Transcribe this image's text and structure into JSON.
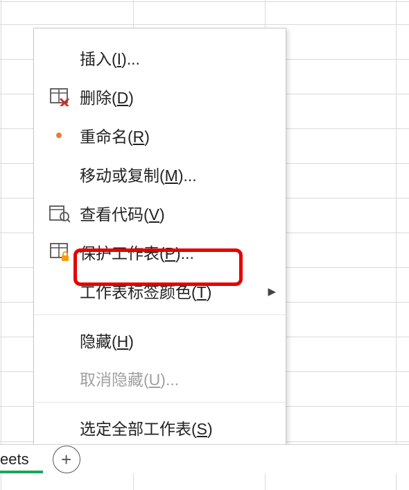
{
  "menu": {
    "items": [
      {
        "id": "insert",
        "label_pre": "插入(",
        "hotkey": "I",
        "label_post": ")...",
        "icon": "",
        "has_submenu": false
      },
      {
        "id": "delete",
        "label_pre": "删除(",
        "hotkey": "D",
        "label_post": ")",
        "icon": "delete-icon",
        "has_submenu": false
      },
      {
        "id": "rename",
        "label_pre": "重命名(",
        "hotkey": "R",
        "label_post": ")",
        "icon": "dot-icon",
        "has_submenu": false
      },
      {
        "id": "move-copy",
        "label_pre": "移动或复制(",
        "hotkey": "M",
        "label_post": ")...",
        "icon": "",
        "has_submenu": false
      },
      {
        "id": "view-code",
        "label_pre": "查看代码(",
        "hotkey": "V",
        "label_post": ")",
        "icon": "viewcode-icon",
        "has_submenu": false
      },
      {
        "id": "protect",
        "label_pre": "保护工作表(",
        "hotkey": "P",
        "label_post": ")...",
        "icon": "protect-icon",
        "has_submenu": false
      },
      {
        "id": "tab-color",
        "label_pre": "工作表标签颜色(",
        "hotkey": "T",
        "label_post": ")",
        "icon": "",
        "has_submenu": true
      },
      {
        "id": "hide",
        "label_pre": "隐藏(",
        "hotkey": "H",
        "label_post": ")",
        "icon": "",
        "has_submenu": false
      },
      {
        "id": "unhide",
        "label_pre": "取消隐藏(",
        "hotkey": "U",
        "label_post": ")...",
        "icon": "",
        "has_submenu": false,
        "disabled": true
      },
      {
        "id": "select-all",
        "label_pre": "选定全部工作表(",
        "hotkey": "S",
        "label_post": ")",
        "icon": "",
        "has_submenu": false
      }
    ]
  },
  "highlight_target": "protect",
  "bottom": {
    "tab_fragment": "eets",
    "new_sheet_glyph": "+"
  },
  "submenu_arrow": "▸"
}
